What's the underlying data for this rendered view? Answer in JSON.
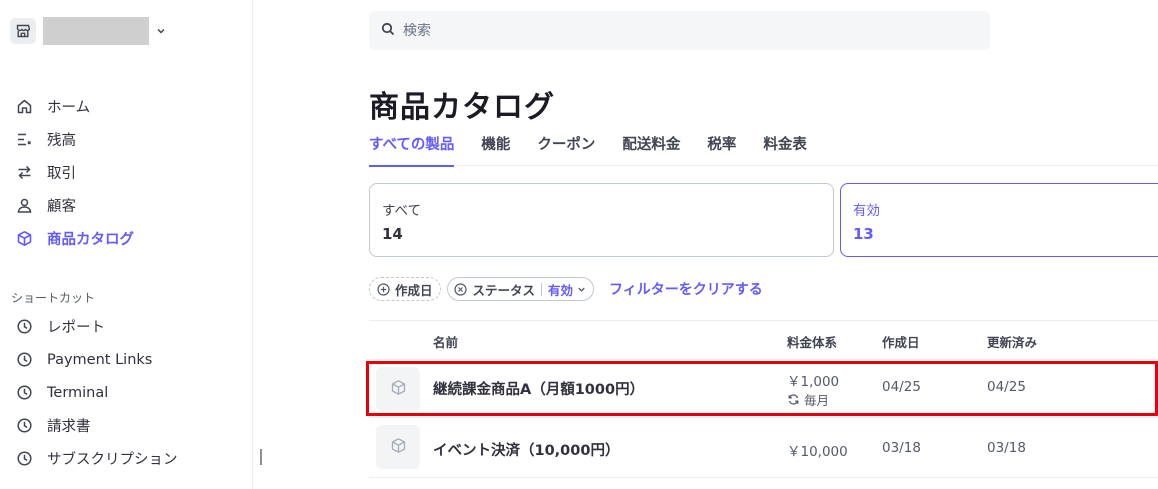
{
  "sidebar": {
    "account": {
      "chevron": "chevron-down-icon"
    },
    "items": [
      {
        "label": "ホーム",
        "icon": "home-icon"
      },
      {
        "label": "残高",
        "icon": "balance-icon"
      },
      {
        "label": "取引",
        "icon": "transfer-icon"
      },
      {
        "label": "顧客",
        "icon": "person-icon"
      },
      {
        "label": "商品カタログ",
        "icon": "box-icon",
        "active": true
      }
    ],
    "shortcut_title": "ショートカット",
    "shortcuts": [
      {
        "label": "レポート",
        "icon": "clock-icon"
      },
      {
        "label": "Payment Links",
        "icon": "clock-icon"
      },
      {
        "label": "Terminal",
        "icon": "clock-icon"
      },
      {
        "label": "請求書",
        "icon": "clock-icon"
      },
      {
        "label": "サブスクリプション",
        "icon": "clock-icon"
      }
    ]
  },
  "search": {
    "placeholder": "検索"
  },
  "page": {
    "title": "商品カタログ"
  },
  "tabs": [
    {
      "label": "すべての製品",
      "active": true
    },
    {
      "label": "機能"
    },
    {
      "label": "クーポン"
    },
    {
      "label": "配送料金"
    },
    {
      "label": "税率"
    },
    {
      "label": "料金表"
    }
  ],
  "summary_cards": [
    {
      "label": "すべて",
      "count": "14"
    },
    {
      "label": "有効",
      "count": "13",
      "selected": true
    }
  ],
  "filters": {
    "created": "作成日",
    "status_label": "ステータス",
    "status_value": "有効",
    "clear": "フィルターをクリアする"
  },
  "table": {
    "headers": {
      "name": "名前",
      "pricing": "料金体系",
      "created": "作成日",
      "updated": "更新済み"
    },
    "rows": [
      {
        "name": "継続課金商品A（月額1000円）",
        "price": "￥1,000",
        "interval": "毎月",
        "created": "04/25",
        "updated": "04/25"
      },
      {
        "name": "イベント決済（10,000円）",
        "price": "￥10,000",
        "created": "03/18",
        "updated": "03/18"
      }
    ]
  },
  "colors": {
    "accent": "#635bff",
    "highlight": "#e6000b",
    "text": "#30313d"
  }
}
